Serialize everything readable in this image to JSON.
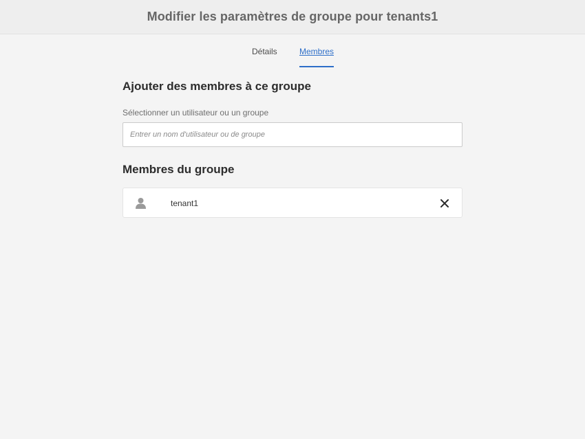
{
  "header": {
    "title": "Modifier les paramètres de groupe pour tenants1"
  },
  "tabs": [
    {
      "label": "Détails",
      "active": false
    },
    {
      "label": "Membres",
      "active": true
    }
  ],
  "add_section": {
    "title": "Ajouter des membres à ce groupe",
    "field_label": "Sélectionner un utilisateur ou un groupe",
    "search_placeholder": "Entrer un nom d'utilisateur ou de groupe",
    "search_value": ""
  },
  "members_section": {
    "title": "Membres du groupe",
    "members": [
      {
        "name": "tenant1",
        "icon": "user-icon",
        "remove_icon": "close-icon"
      }
    ]
  },
  "colors": {
    "accent": "#2d6ec8",
    "background": "#f4f4f4",
    "header_background": "#eeeeee"
  }
}
